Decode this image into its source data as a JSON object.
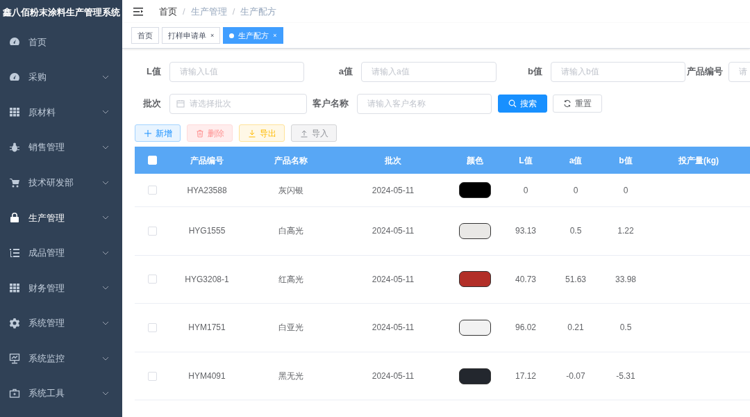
{
  "sidebar": {
    "title": "鑫八佰粉末涂料生产管理系统",
    "items": [
      {
        "label": "首页",
        "kind": "gauge",
        "expandable": false,
        "selected": false
      },
      {
        "label": "采购",
        "kind": "gauge",
        "expandable": true,
        "selected": false
      },
      {
        "label": "原材料",
        "kind": "grid",
        "expandable": true,
        "selected": false
      },
      {
        "label": "销售管理",
        "kind": "bug",
        "expandable": true,
        "selected": false
      },
      {
        "label": "技术研发部",
        "kind": "cart",
        "expandable": true,
        "selected": false
      },
      {
        "label": "生产管理",
        "kind": "lock",
        "expandable": true,
        "selected": true
      },
      {
        "label": "成品管理",
        "kind": "list",
        "expandable": true,
        "selected": false
      },
      {
        "label": "财务管理",
        "kind": "grid",
        "expandable": true,
        "selected": false
      },
      {
        "label": "系统管理",
        "kind": "gear",
        "expandable": true,
        "selected": false
      },
      {
        "label": "系统监控",
        "kind": "monitor",
        "expandable": true,
        "selected": false
      },
      {
        "label": "系统工具",
        "kind": "toolbox",
        "expandable": true,
        "selected": false
      }
    ]
  },
  "breadcrumb": {
    "separator": "/",
    "items": [
      "首页",
      "生产管理",
      "生产配方"
    ]
  },
  "tabs": [
    {
      "label": "首页",
      "selected": false
    },
    {
      "label": "打样申请单",
      "close": "×",
      "selected": false
    },
    {
      "label": "生产配方",
      "close": "×",
      "selected": true
    }
  ],
  "filters": [
    [
      {
        "label": "L值",
        "placeholder": "请输入L值",
        "kind": "text"
      },
      {
        "label": "a值",
        "placeholder": "请输入a值",
        "kind": "text"
      },
      {
        "label": "b值",
        "placeholder": "请输入b值",
        "kind": "text"
      },
      {
        "label": "产品编号",
        "placeholder": "请",
        "kind": "text"
      }
    ],
    [
      {
        "label": "批次",
        "placeholder": "请选择批次",
        "kind": "date"
      },
      {
        "label": "客户名称",
        "placeholder": "请输入客户名称",
        "kind": "text"
      }
    ]
  ],
  "search_buttons": [
    {
      "label": "搜索",
      "kind": "primary"
    },
    {
      "label": "重置",
      "kind": "plain"
    }
  ],
  "actions": [
    {
      "label": "新增",
      "kind": "add"
    },
    {
      "label": "删除",
      "kind": "delete"
    },
    {
      "label": "导出",
      "kind": "export"
    },
    {
      "label": "导入",
      "kind": "import"
    }
  ],
  "table": {
    "select_all": false,
    "columns": [
      "产品编号",
      "产品名称",
      "批次",
      "颜色",
      "L值",
      "a值",
      "b值",
      "投产量(kg)"
    ],
    "rows": [
      {
        "checked": false,
        "code": "HYA23588",
        "name": "灰闪银",
        "batch": "2024-05-11",
        "color": "#000000",
        "L": "0",
        "a": "0",
        "b": "0"
      },
      {
        "checked": false,
        "code": "HYG1555",
        "name": "白高光",
        "batch": "2024-05-11",
        "color": "#e9e8e6",
        "L": "93.13",
        "a": "0.5",
        "b": "1.22"
      },
      {
        "checked": false,
        "code": "HYG3208-1",
        "name": "红高光",
        "batch": "2024-05-11",
        "color": "#b22f28",
        "L": "40.73",
        "a": "51.63",
        "b": "33.98"
      },
      {
        "checked": false,
        "code": "HYM1751",
        "name": "白亚光",
        "batch": "2024-05-11",
        "color": "#f2f2f2",
        "L": "96.02",
        "a": "0.21",
        "b": "0.5"
      },
      {
        "checked": false,
        "code": "HYM4091",
        "name": "黑无光",
        "batch": "2024-05-11",
        "color": "#23272e",
        "L": "17.12",
        "a": "-0.07",
        "b": "-5.31"
      }
    ]
  }
}
